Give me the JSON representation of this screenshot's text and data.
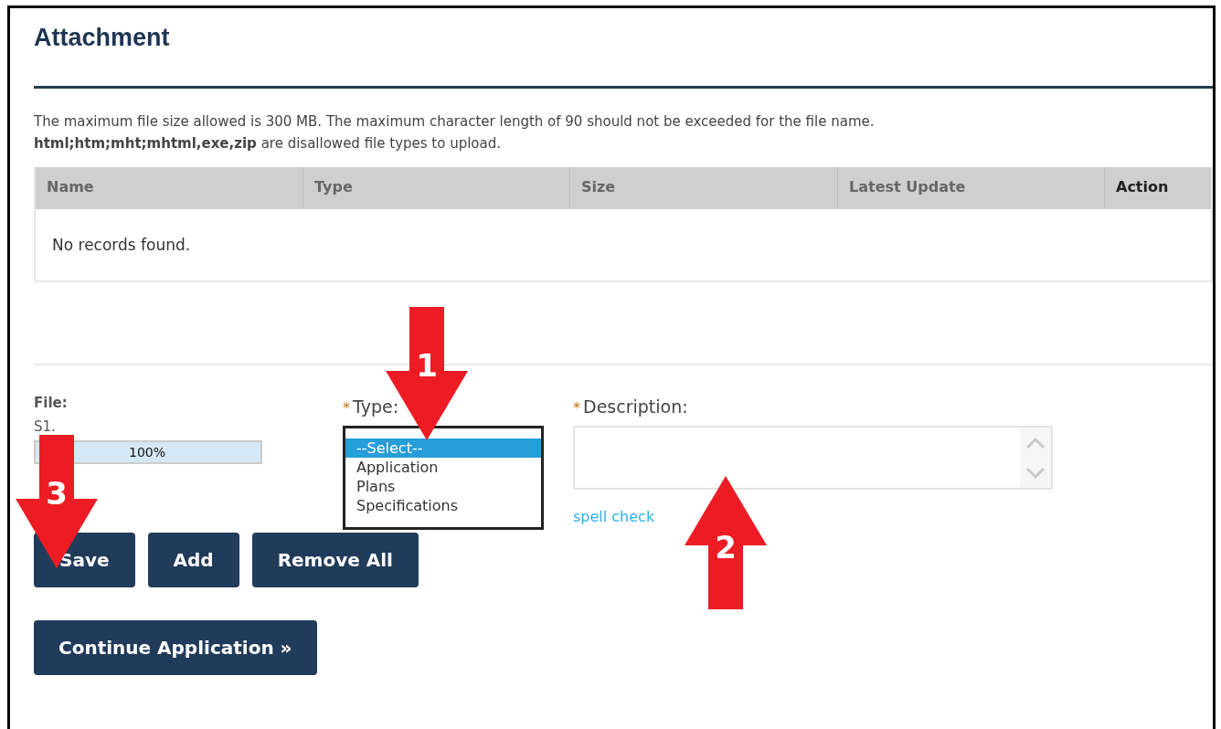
{
  "title": "Attachment",
  "notice": [
    "The maximum file size allowed is 300 MB. The maximum character length of 90 should not be exceeded for the file name.",
    "**html;htm;mht;mhtml,exe,zip** are disallowed file types to upload."
  ],
  "table": {
    "columns": [
      "Name",
      "Type",
      "Size",
      "Latest Update",
      "Action"
    ],
    "empty_text": "No records found."
  },
  "file": {
    "label": "File:",
    "name": "S1.",
    "progress_text": "100%",
    "level": 1
  },
  "type_field": {
    "required_mark": "*",
    "label": "Type:",
    "options": [
      {
        "label": "--Select--",
        "selected": true
      },
      {
        "label": "Application",
        "selected": false
      },
      {
        "label": "Plans",
        "selected": false
      },
      {
        "label": "Specifications",
        "selected": false
      }
    ]
  },
  "description_field": {
    "required_mark": "*",
    "label": "Description:",
    "link": "spell check"
  },
  "buttons": [
    "Save",
    "Add",
    "Remove All"
  ],
  "continue_button": "Continue Application »",
  "callouts": [
    {
      "number": "1",
      "kind": "down"
    },
    {
      "number": "2",
      "kind": "up"
    },
    {
      "number": "3",
      "kind": "down"
    }
  ]
}
